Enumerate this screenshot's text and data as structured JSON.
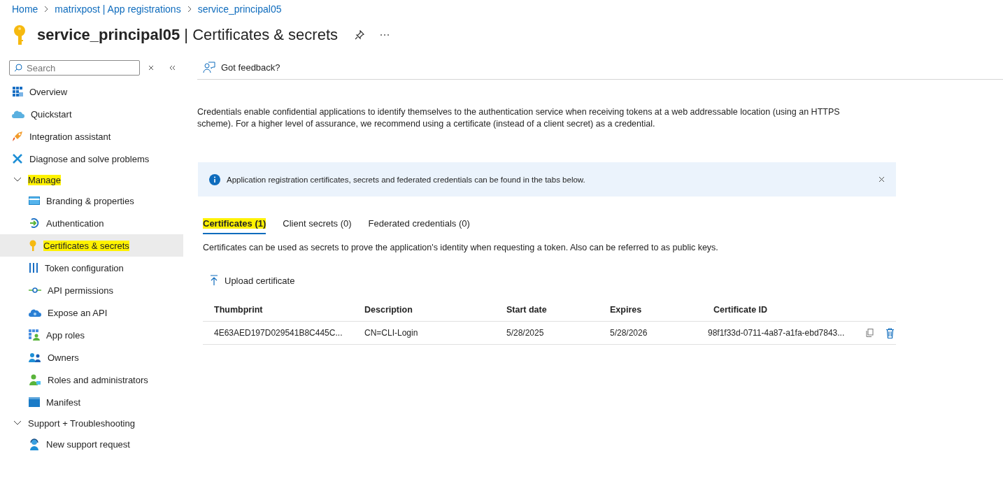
{
  "breadcrumb": [
    "Home",
    "matrixpost | App registrations",
    "service_principal05"
  ],
  "title": {
    "resource": "service_principal05",
    "separator": "|",
    "page": "Certificates & secrets"
  },
  "sidebar": {
    "search": {
      "placeholder": "Search"
    },
    "items": [
      {
        "kind": "item",
        "label": "Overview",
        "selected": false,
        "highlighted": false
      },
      {
        "kind": "item",
        "label": "Quickstart",
        "selected": false,
        "highlighted": false
      },
      {
        "kind": "item",
        "label": "Integration assistant",
        "selected": false,
        "highlighted": false
      },
      {
        "kind": "item",
        "label": "Diagnose and solve problems",
        "selected": false,
        "highlighted": false
      },
      {
        "kind": "group",
        "label": "Manage",
        "expanded": true,
        "highlighted": true,
        "children": [
          {
            "label": "Branding & properties",
            "selected": false,
            "highlighted": false
          },
          {
            "label": "Authentication",
            "selected": false,
            "highlighted": false
          },
          {
            "label": "Certificates & secrets",
            "selected": true,
            "highlighted": true
          },
          {
            "label": "Token configuration",
            "selected": false,
            "highlighted": false
          },
          {
            "label": "API permissions",
            "selected": false,
            "highlighted": false
          },
          {
            "label": "Expose an API",
            "selected": false,
            "highlighted": false
          },
          {
            "label": "App roles",
            "selected": false,
            "highlighted": false
          },
          {
            "label": "Owners",
            "selected": false,
            "highlighted": false
          },
          {
            "label": "Roles and administrators",
            "selected": false,
            "highlighted": false
          },
          {
            "label": "Manifest",
            "selected": false,
            "highlighted": false
          }
        ]
      },
      {
        "kind": "group",
        "label": "Support + Troubleshooting",
        "expanded": true,
        "highlighted": false,
        "children": [
          {
            "label": "New support request",
            "selected": false,
            "highlighted": false
          }
        ]
      }
    ]
  },
  "toolbar": {
    "feedback": "Got feedback?"
  },
  "description": "Credentials enable confidential applications to identify themselves to the authentication service when receiving tokens at a web addressable location (using an HTTPS scheme). For a higher level of assurance, we recommend using a certificate (instead of a client secret) as a credential.",
  "info_banner": "Application registration certificates, secrets and federated credentials can be found in the tabs below.",
  "tabs": [
    {
      "label": "Certificates (1)",
      "selected": true,
      "highlighted": true
    },
    {
      "label": "Client secrets (0)",
      "selected": false,
      "highlighted": false
    },
    {
      "label": "Federated credentials (0)",
      "selected": false,
      "highlighted": false
    }
  ],
  "tab_caption": "Certificates can be used as secrets to prove the application's identity when requesting a token. Also can be referred to as public keys.",
  "upload_button": "Upload certificate",
  "table": {
    "columns": [
      "Thumbprint",
      "Description",
      "Start date",
      "Expires",
      "Certificate ID"
    ],
    "rows": [
      [
        "4E63AED197D029541B8C445C...",
        "CN=CLI-Login",
        "5/28/2025",
        "5/28/2026",
        "98f1f33d-0711-4a87-a1fa-ebd7843..."
      ]
    ]
  }
}
